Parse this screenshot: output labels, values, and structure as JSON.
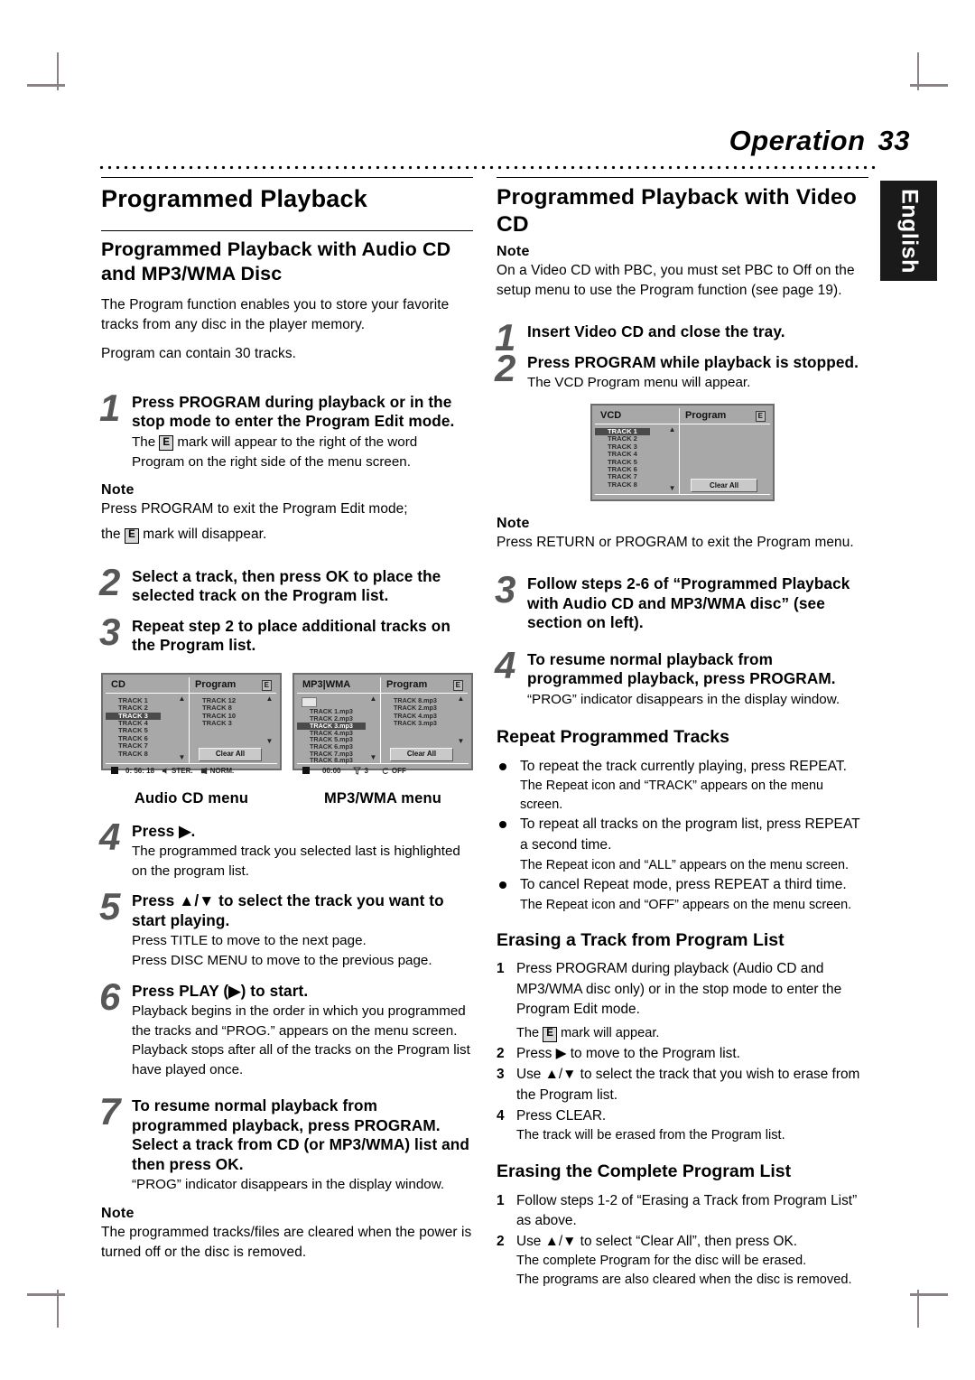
{
  "header": {
    "title": "Operation",
    "page_number": "33",
    "language_tab": "English"
  },
  "left_column": {
    "main_title": "Programmed Playback",
    "subhead": "Programmed Playback with Audio CD and MP3/WMA Disc",
    "intro_p1": "The Program function enables you to store your favorite tracks from any disc in the player memory.",
    "intro_p2": "Program can contain 30 tracks.",
    "step1": {
      "num": "1",
      "lead": "Press PROGRAM during playback or in the stop mode to enter the Program Edit mode.",
      "sub_pre": "The",
      "sub_post": "mark will appear to the right of the word Program on the right side of the menu screen."
    },
    "note1": {
      "label": "Note",
      "line1": "Press PROGRAM to exit the Program Edit mode;",
      "line2_pre": "the",
      "line2_post": "mark will disappear."
    },
    "step2": {
      "num": "2",
      "lead": "Select a track, then press OK to place the selected track on the Program list."
    },
    "step3": {
      "num": "3",
      "lead": "Repeat step 2 to place additional tracks on the Program list."
    },
    "step4": {
      "num": "4",
      "lead": "Press ▶.",
      "sub": "The programmed track you selected last is highlighted on the program list."
    },
    "step5": {
      "num": "5",
      "lead": "Press ▲/▼ to select the track you want to start playing.",
      "sub1": "Press TITLE to move to the next page.",
      "sub2": "Press DISC MENU to move to the previous page."
    },
    "step6": {
      "num": "6",
      "lead": "Press PLAY (▶) to start.",
      "sub1": "Playback begins in the order in which you programmed the tracks and “PROG.” appears on the menu screen.",
      "sub2": "Playback stops after all of the tracks on the Program list have played once."
    },
    "step7": {
      "num": "7",
      "lead": "To resume normal playback from programmed playback, press PROGRAM. Select a track from CD (or MP3/WMA) list and then press OK.",
      "sub": "“PROG” indicator disappears in the display window."
    },
    "note2": {
      "label": "Note",
      "text": "The programmed tracks/files are cleared when the power is turned off or the disc is removed."
    }
  },
  "osd_cd": {
    "caption": "Audio CD menu",
    "source_header": "CD",
    "program_header": "Program",
    "edit_mark": "E",
    "source_tracks": [
      "TRACK 1",
      "TRACK 2",
      "TRACK 3",
      "TRACK 4",
      "TRACK 5",
      "TRACK 6",
      "TRACK 7",
      "TRACK 8"
    ],
    "selected_track": "TRACK 3",
    "program_tracks": [
      "TRACK 12",
      "TRACK 8",
      "TRACK 10",
      "TRACK 3"
    ],
    "clear_all": "Clear All",
    "status": {
      "time": "0: 56: 18",
      "audio": "STER.",
      "mode": "NORM."
    }
  },
  "osd_mp3": {
    "caption": "MP3/WMA menu",
    "source_header": "MP3|WMA",
    "program_header": "Program",
    "edit_mark": "E",
    "source_tracks": [
      "TRACK 1.mp3",
      "TRACK 2.mp3",
      "TRACK 3.mp3",
      "TRACK 4.mp3",
      "TRACK 5.mp3",
      "TRACK 6.mp3",
      "TRACK 7.mp3",
      "TRACK 8.mp3"
    ],
    "selected_track": "TRACK 3.mp3",
    "program_tracks": [
      "TRACK 8.mp3",
      "TRACK 2.mp3",
      "TRACK 4.mp3",
      "TRACK 3.mp3"
    ],
    "clear_all": "Clear All",
    "status": {
      "time": "00:00",
      "filter_count": "3",
      "repeat": "OFF"
    }
  },
  "osd_vcd": {
    "source_header": "VCD",
    "program_header": "Program",
    "edit_mark": "E",
    "source_tracks": [
      "TRACK 1",
      "TRACK 2",
      "TRACK 3",
      "TRACK 4",
      "TRACK 5",
      "TRACK 6",
      "TRACK 7",
      "TRACK 8"
    ],
    "selected_track": "TRACK 1",
    "program_tracks": [],
    "clear_all": "Clear All"
  },
  "right_column": {
    "title": "Programmed Playback with Video CD",
    "note1": {
      "label": "Note",
      "text": "On a Video CD with PBC, you must set PBC to Off on the setup menu to use the Program function (see page 19)."
    },
    "step1": {
      "num": "1",
      "lead": "Insert Video CD and close the tray."
    },
    "step2": {
      "num": "2",
      "lead": "Press PROGRAM while playback is stopped.",
      "sub": "The VCD Program menu will appear."
    },
    "note2": {
      "label": "Note",
      "text": "Press RETURN or PROGRAM to exit the Program menu."
    },
    "step3": {
      "num": "3",
      "lead": "Follow steps 2-6 of “Programmed Playback with Audio CD and MP3/WMA disc” (see section on left)."
    },
    "step4": {
      "num": "4",
      "lead": "To resume normal playback from programmed playback, press PROGRAM.",
      "sub": "“PROG” indicator disappears in the display window."
    },
    "repeat_section": {
      "heading": "Repeat Programmed Tracks",
      "items": [
        {
          "main": "To repeat the track currently playing, press REPEAT.",
          "sub": "The Repeat icon and “TRACK” appears on the menu screen."
        },
        {
          "main": "To repeat all tracks on the program list, press REPEAT a second time.",
          "sub": "The Repeat icon and “ALL” appears on the menu screen."
        },
        {
          "main": "To cancel Repeat mode, press REPEAT a third time.",
          "sub": "The Repeat icon and “OFF” appears on the menu screen."
        }
      ]
    },
    "erase_track_section": {
      "heading": "Erasing a Track from Program List",
      "step1_num": "1",
      "step1_text": "Press PROGRAM during playback  (Audio CD and MP3/WMA disc only) or in the stop mode to enter the Program Edit mode.",
      "step1_sub_pre": "The",
      "step1_sub_post": "mark will appear.",
      "step2_num": "2",
      "step2_text": "Press ▶ to move to the Program list.",
      "step3_num": "3",
      "step3_text": "Use ▲/▼ to select the track that you wish to erase from the Program list.",
      "step4_num": "4",
      "step4_text": "Press CLEAR.",
      "step4_sub": "The track will be erased from the Program list."
    },
    "erase_all_section": {
      "heading": "Erasing the Complete Program List",
      "step1_num": "1",
      "step1_text": "Follow steps 1-2 of “Erasing a Track from Program List” as above.",
      "step2_num": "2",
      "step2_text": "Use ▲/▼ to select “Clear All”, then press OK.",
      "step2_sub1": "The complete Program for the disc will be erased.",
      "step2_sub2": "The programs are also cleared when the disc is removed."
    }
  }
}
